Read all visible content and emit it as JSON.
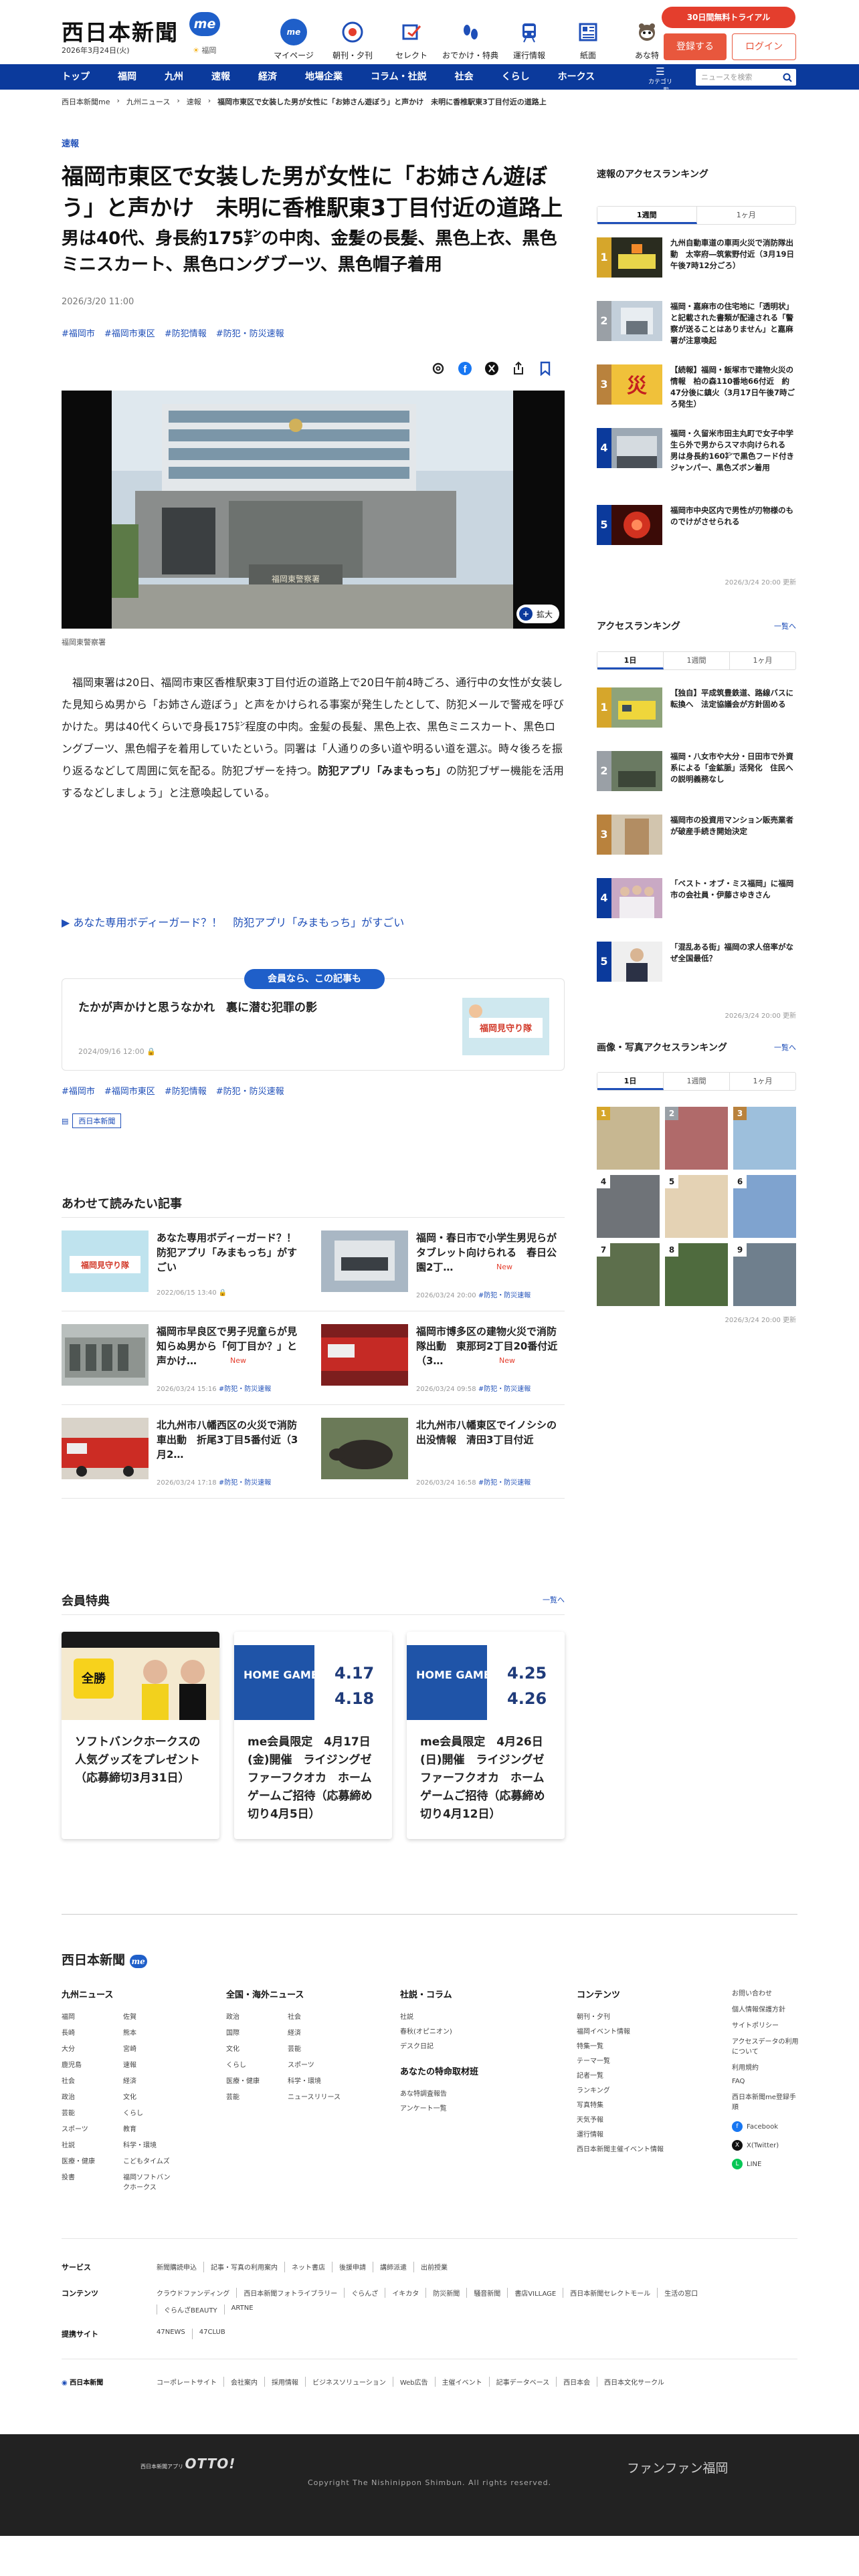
{
  "header": {
    "logo": "西日本新聞",
    "me": "me",
    "date": "2026年3月24日(火)",
    "weather": "福岡",
    "icons": [
      {
        "label": "マイページ",
        "icon": "me-icon"
      },
      {
        "label": "朝刊・夕刊",
        "icon": "paper-icon"
      },
      {
        "label": "セレクト",
        "icon": "select-icon"
      },
      {
        "label": "おでかけ・特典",
        "icon": "footprint-icon"
      },
      {
        "label": "運行情報",
        "icon": "train-icon"
      },
      {
        "label": "紙面",
        "icon": "page-icon"
      },
      {
        "label": "あな特",
        "icon": "raccoon-icon"
      }
    ],
    "trial": "30日間無料トライアル",
    "register": "登録する",
    "login": "ログイン"
  },
  "nav": {
    "items": [
      "トップ",
      "福岡",
      "九州",
      "速報",
      "経済",
      "地場企業",
      "コラム・社説",
      "社会",
      "くらし",
      "ホークス"
    ],
    "category": "カテゴリー一覧",
    "search_placeholder": "ニュースを検索"
  },
  "breadcrumb": [
    "西日本新聞me",
    "九州ニュース",
    "速報",
    "福岡市東区で女装した男が女性に「お姉さん遊ぼう」と声かけ　未明に香椎駅東3丁目付近の道路上"
  ],
  "article": {
    "category": "速報",
    "title": "福岡市東区で女装した男が女性に「お姉さん遊ぼう」と声かけ　未明に香椎駅東3丁目付近の道路上",
    "subtitle": "男は40代、身長約175㌢の中肉、金髪の長髪、黒色上衣、黒色ミニスカート、黒色ロングブーツ、黒色帽子着用",
    "date": "2026/3/20 11:00",
    "tags": [
      "#福岡市",
      "#福岡市東区",
      "#防犯情報",
      "#防犯・防災速報"
    ],
    "zoom": "拡大",
    "caption": "福岡東警察署",
    "building_sign": "福岡東警察署",
    "body_a": "福岡東署は20日、福岡市東区香椎駅東3丁目付近の道路上で20日午前4時ごろ、通行中の女性が女装した見知らぬ男から「お姉さん遊ぼう」と声をかけられる事案が発生したとして、防犯メールで警戒を呼びかけた。男は40代くらいで身長175㌢程度の中肉。金髪の長髪、黒色上衣、黒色ミニスカート、黒色ロングブーツ、黒色帽子を着用していたという。同署は「人通りの多い道や明るい道を選ぶ。時々後ろを振り返るなどして周囲に気を配る。防犯ブザーを持つ。",
    "body_bold": "防犯アプリ「みまもっち」",
    "body_b": "の防犯ブザー機能を活用するなどしましょう」と注意喚起している。",
    "related_links": [
      "▶ あなた専用ボディーガード？！　防犯アプリ「みまもっち」がすごい"
    ],
    "member_badge": "会員なら、この記事も",
    "member_title": "たかが声かけと思うなかれ　裏に潜む犯罪の影",
    "member_date": "2024/09/16 12:00",
    "source": "西日本新聞"
  },
  "related": {
    "heading": "あわせて読みたい記事",
    "items": [
      {
        "title": "あなた専用ボディーガード？！　防犯アプリ「みまもっち」がすごい",
        "date": "2022/06/15 13:40",
        "tag": "",
        "new": ""
      },
      {
        "title": "福岡・春日市で小学生男児らがタブレット向けられる　春日公園2丁…",
        "date": "2026/03/24 20:00",
        "tag": "#防犯・防災速報",
        "new": "New"
      },
      {
        "title": "福岡市早良区で男子児童らが見知らぬ男から「何丁目か？」と声かけ…",
        "date": "2026/03/24 15:16",
        "tag": "#防犯・防災速報",
        "new": "New"
      },
      {
        "title": "福岡市博多区の建物火災で消防隊出動　東那珂2丁目20番付近（3…",
        "date": "2026/03/24 09:58",
        "tag": "#防犯・防災速報",
        "new": "New"
      },
      {
        "title": "北九州市八幡西区の火災で消防車出動　折尾3丁目5番付近（3月2…",
        "date": "2026/03/24 17:18",
        "tag": "#防犯・防災速報",
        "new": ""
      },
      {
        "title": "北九州市八幡東区でイノシシの出没情報　清田3丁目付近",
        "date": "2026/03/24 16:58",
        "tag": "#防犯・防災速報",
        "new": ""
      }
    ]
  },
  "perks": {
    "heading": "会員特典",
    "more": "一覧へ",
    "items": [
      {
        "title": "ソフトバンクホークスの人気グッズをプレゼント（応募締切3月31日）",
        "img": "all-for-win-hawks"
      },
      {
        "title": "me会員限定　4月17日(金)開催　ライジングゼファーフクオカ　ホームゲームご招待（応募締め切り4月5日）",
        "img": "HOME GAME",
        "d1": "4.17",
        "d2": "4.18"
      },
      {
        "title": "me会員限定　4月26日(日)開催　ライジングゼファーフクオカ　ホームゲームご招待（応募締め切り4月12日）",
        "img": "HOME GAME",
        "d1": "4.25",
        "d2": "4.26"
      }
    ]
  },
  "sidebar": {
    "breaking_heading": "速報のアクセスランキング",
    "breaking_tabs": [
      "1週間",
      "1ヶ月"
    ],
    "breaking_items": [
      "九州自動車道の車両火災で消防隊出動　太宰府―筑紫野付近（3月19日午後7時12分ごろ）",
      "福岡・嘉麻市の住宅地に「透明状」と記載された書類が配達される「警察が送ることはありません」と嘉麻署が注意喚起",
      "【続報】福岡・飯塚市で建物火災の情報　柏の森110番地66付近　約47分後に鎮火（3月17日午後7時ごろ発生）",
      "福岡・久留米市田主丸町で女子中学生ら外で男からスマホ向けられる　男は身長約160㌢で黒色フード付きジャンパー、黒色ズボン着用",
      "福岡市中央区内で男性が刃物様のものでけがさせられる"
    ],
    "breaking_updated": "2026/3/24 20:00 更新",
    "access_heading": "アクセスランキング",
    "access_more": "一覧へ",
    "access_tabs": [
      "1日",
      "1週間",
      "1ヶ月"
    ],
    "access_items": [
      "【独自】平成筑豊鉄道、路線バスに転換へ　法定協議会が方針固める",
      "福岡・八女市や大分・日田市で外資系による「金鉱脈」活発化　住民への説明義務なし",
      "福岡市の投資用マンション販売業者が破産手続き開始決定",
      "「ベスト・オブ・ミス福岡」に福岡市の会社員・伊藤さゆきさん",
      "「混乱ある街」福岡の求人倍率がなぜ全国最低？"
    ],
    "access_updated": "2026/3/24 20:00 更新",
    "photo_heading": "画像・写真アクセスランキング",
    "photo_more": "一覧へ",
    "photo_tabs": [
      "1日",
      "1週間",
      "1ヶ月"
    ],
    "photo_updated": "2026/3/24 20:00 更新"
  },
  "footer": {
    "logo": "西日本新聞",
    "col1_title": "九州ニュース",
    "col1": [
      "福岡",
      "長崎",
      "大分",
      "鹿児島",
      "社会",
      "政治",
      "芸能",
      "スポーツ",
      "社説",
      "医療・健康",
      "投書"
    ],
    "col1b": [
      "佐賀",
      "熊本",
      "宮崎",
      "速報",
      "経済",
      "文化",
      "くらし",
      "教育",
      "科学・環境",
      "こどもタイムズ",
      "福岡ソフトバンクホークス"
    ],
    "col2_title": "全国・海外ニュース",
    "col2": [
      "政治",
      "国際",
      "文化",
      "くらし",
      "医療・健康",
      "芸能"
    ],
    "col2b": [
      "社会",
      "経済",
      "芸能",
      "スポーツ",
      "科学・環境",
      "ニュースリリース"
    ],
    "col3_title": "社説・コラム",
    "col3": [
      "社説",
      "春秋(オピニオン)",
      "デスク日記"
    ],
    "col3b_title": "あなたの特命取材班",
    "col3b": [
      "あな特調査報告",
      "アンケート一覧"
    ],
    "col4_title": "コンテンツ",
    "col4": [
      "朝刊・夕刊",
      "福岡イベント情報",
      "特集一覧",
      "テーマ一覧",
      "記者一覧",
      "ランキング",
      "写真特集",
      "天気予報",
      "運行情報",
      "西日本新聞主催イベント情報"
    ],
    "col5": [
      "お問い合わせ",
      "個人情報保護方針",
      "サイトポリシー",
      "アクセスデータの利用について",
      "利用規約",
      "FAQ",
      "西日本新聞me登録手順"
    ],
    "sns": [
      {
        "name": "Facebook",
        "icon": "facebook-icon"
      },
      {
        "name": "X(Twitter)",
        "icon": "x-icon"
      },
      {
        "name": "LINE",
        "icon": "line-icon"
      }
    ],
    "service_label": "サービス",
    "service": [
      "新聞購読申込",
      "記事・写真の利用案内",
      "ネット書店",
      "後援申請",
      "講師派遣",
      "出前授業"
    ],
    "contents_label": "コンテンツ",
    "contents": [
      "クラウドファンディング",
      "西日本新聞フォトライブラリー",
      "ぐらんざ",
      "イキカタ",
      "防災新聞",
      "騒音新聞",
      "書店VILLAGE",
      "西日本新聞セレクトモール",
      "生活の窓口",
      "ぐらんざBEAUTY",
      "ARTNE"
    ],
    "partner_label": "提携サイト",
    "partner": [
      "47NEWS",
      "47CLUB"
    ],
    "company_logo": "西日本新聞",
    "company": [
      "コーポレートサイト",
      "会社案内",
      "採用情報",
      "ビジネスソリューション",
      "Web広告",
      "主催イベント",
      "記事データベース",
      "西日本会",
      "西日本文化サークル"
    ],
    "otto_small": "西日本新聞アプリ",
    "otto": "OTTO!",
    "fanfan": "ファンファン福岡",
    "copyright": "Copyright The Nishinippon Shimbun. All rights reserved."
  },
  "colors": {
    "nav": "#0b3a9c",
    "accent": "#1f4fb8",
    "trial": "#e43e2d"
  }
}
